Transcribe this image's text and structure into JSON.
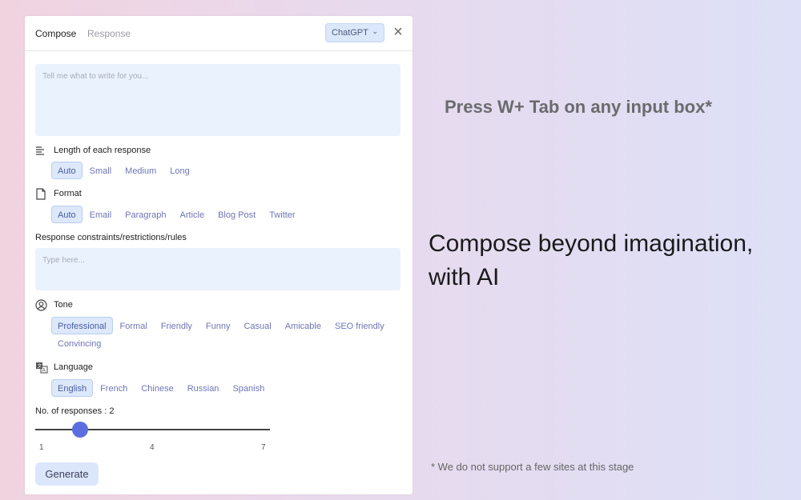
{
  "tabs": [
    {
      "label": "Compose"
    },
    {
      "label": "Response"
    }
  ],
  "model": {
    "label": "ChatGPT"
  },
  "prompt": {
    "placeholder": "Tell me what to write for you..."
  },
  "length": {
    "title": "Length of each response",
    "options": [
      "Auto",
      "Small",
      "Medium",
      "Long"
    ],
    "selected": "Auto"
  },
  "format": {
    "title": "Format",
    "options": [
      "Auto",
      "Email",
      "Paragraph",
      "Article",
      "Blog Post",
      "Twitter"
    ],
    "selected": "Auto"
  },
  "constraints": {
    "title": "Response constraints/restrictions/rules",
    "placeholder": "Type here..."
  },
  "tone": {
    "title": "Tone",
    "options": [
      "Professional",
      "Formal",
      "Friendly",
      "Funny",
      "Casual",
      "Amicable",
      "SEO friendly",
      "Convincing"
    ],
    "selected": "Professional"
  },
  "language": {
    "title": "Language",
    "options": [
      "English",
      "French",
      "Chinese",
      "Russian",
      "Spanish"
    ],
    "selected": "English"
  },
  "responses": {
    "label": "No. of responses : 2",
    "value": 2,
    "min": 1,
    "max": 7,
    "ticks": [
      "1",
      "4",
      "7"
    ]
  },
  "generate": {
    "label": "Generate"
  },
  "marketing": {
    "hint": "Press W+ Tab on any input box*",
    "headline": "Compose beyond imagination, with AI",
    "footnote": "* We do not support a few sites at this stage"
  },
  "colors": {
    "accent": "#5b6ee0",
    "chip_selected_bg": "#dde8fb",
    "input_bg": "#eaf2fd"
  }
}
